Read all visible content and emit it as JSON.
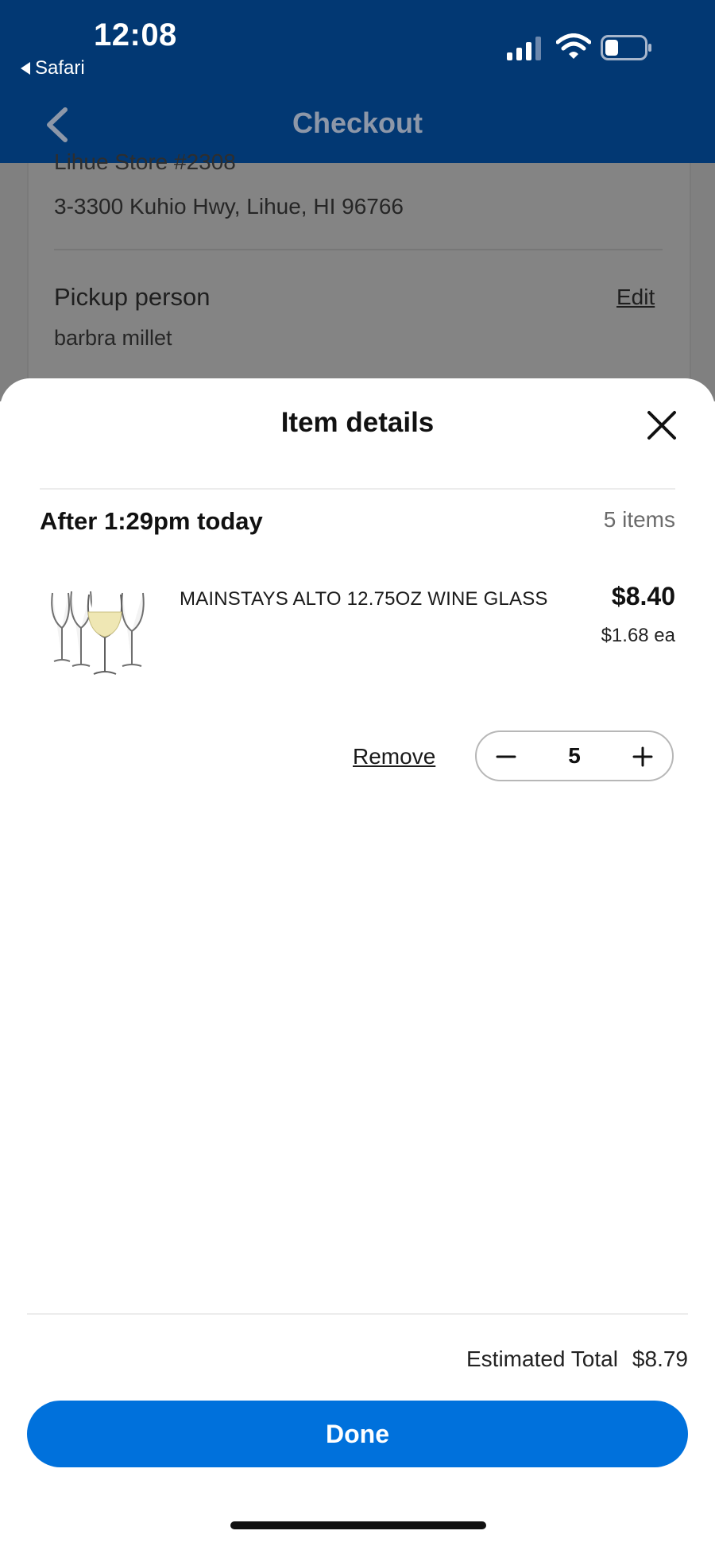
{
  "status_bar": {
    "time": "12:08",
    "back_app_label": "Safari",
    "icons": [
      "signal-icon",
      "wifi-icon",
      "battery-icon"
    ]
  },
  "nav": {
    "title": "Checkout",
    "back_icon": "chevron-left-icon"
  },
  "background_page": {
    "store_name": "Lihue Store #2308",
    "store_address": "3-3300 Kuhio Hwy, Lihue, HI 96766",
    "pickup_title": "Pickup person",
    "pickup_name": "barbra millet",
    "edit_label": "Edit"
  },
  "sheet": {
    "title": "Item details",
    "close_icon": "close-icon",
    "slot_title": "After 1:29pm today",
    "item_count": "5 items",
    "item": {
      "image_icon": "wine-glasses-image",
      "name": "MAINSTAYS ALTO 12.75OZ WINE GLASS",
      "price": "$8.40",
      "unit_price": "$1.68 ea",
      "quantity": "5",
      "remove_label": "Remove"
    },
    "total_label": "Estimated Total",
    "total_value": "$8.79",
    "done_label": "Done"
  },
  "colors": {
    "header_bg": "#023873",
    "primary_button": "#0071dc",
    "dim_overlay": "#808080"
  }
}
